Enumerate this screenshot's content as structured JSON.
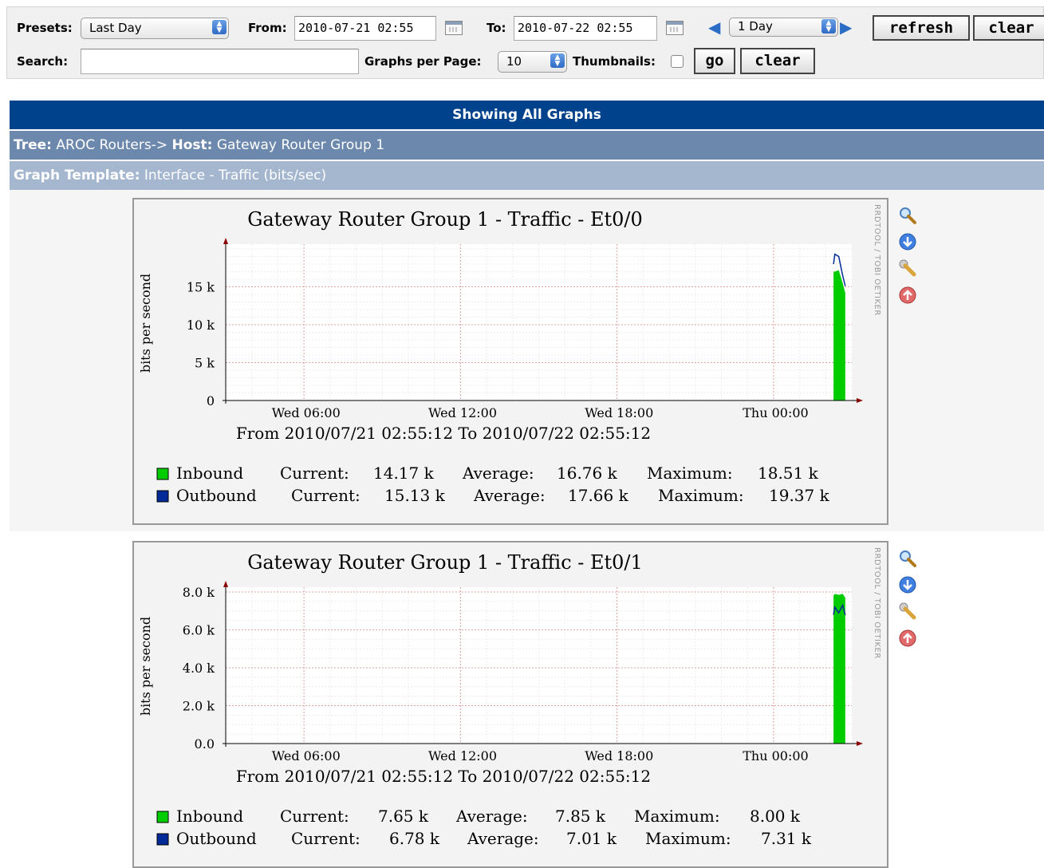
{
  "filter": {
    "presets_label": "Presets:",
    "presets_value": "Last Day",
    "from_label": "From:",
    "from_value": "2010-07-21 02:55",
    "to_label": "To:",
    "to_value": "2010-07-22 02:55",
    "timespan_value": "1 Day",
    "refresh_label": "refresh",
    "clear_label": "clear",
    "search_label": "Search:",
    "search_value": "",
    "graphs_per_page_label": "Graphs per Page:",
    "graphs_per_page_value": "10",
    "thumbnails_label": "Thumbnails:",
    "go_label": "go",
    "clear2_label": "clear"
  },
  "header": {
    "showing": "Showing All Graphs",
    "tree_label": "Tree:",
    "tree_value": "AROC Routers->",
    "host_label": "Host:",
    "host_value": "Gateway Router Group 1",
    "template_label": "Graph Template:",
    "template_value": "Interface - Traffic (bits/sec)"
  },
  "icons": [
    "zoom-icon",
    "export-icon",
    "settings-icon",
    "move-up-icon"
  ],
  "colors": {
    "inbound": "#00cc00",
    "outbound": "#002a97",
    "header": "#00438c"
  },
  "graphs": [
    {
      "title": "Gateway Router Group 1 - Traffic - Et0/0",
      "ylabel": "bits per second",
      "side_label": "RRDTOOL / TOBI OETIKER",
      "yticks": [
        "0",
        "5 k",
        "10 k",
        "15 k"
      ],
      "xticks": [
        "Wed 06:00",
        "Wed 12:00",
        "Wed 18:00",
        "Thu 00:00"
      ],
      "subtitle": "From 2010/07/21 02:55:12 To 2010/07/22 02:55:12",
      "legend": {
        "inbound": {
          "name": "Inbound",
          "current_label": "Current:",
          "current": "14.17 k",
          "average_label": "Average:",
          "average": "16.76 k",
          "maximum_label": "Maximum:",
          "maximum": "18.51 k"
        },
        "outbound": {
          "name": "Outbound",
          "current_label": "Current:",
          "current": "15.13 k",
          "average_label": "Average:",
          "average": "17.66 k",
          "maximum_label": "Maximum:",
          "maximum": "19.37 k"
        }
      }
    },
    {
      "title": "Gateway Router Group 1 - Traffic - Et0/1",
      "ylabel": "bits per second",
      "side_label": "RRDTOOL / TOBI OETIKER",
      "yticks": [
        "0.0",
        "2.0 k",
        "4.0 k",
        "6.0 k",
        "8.0 k"
      ],
      "xticks": [
        "Wed 06:00",
        "Wed 12:00",
        "Wed 18:00",
        "Thu 00:00"
      ],
      "subtitle": "From 2010/07/21 02:55:12 To 2010/07/22 02:55:12",
      "legend": {
        "inbound": {
          "name": "Inbound",
          "current_label": "Current:",
          "current": "7.65 k",
          "average_label": "Average:",
          "average": "7.85 k",
          "maximum_label": "Maximum:",
          "maximum": "8.00 k"
        },
        "outbound": {
          "name": "Outbound",
          "current_label": "Current:",
          "current": "6.78 k",
          "average_label": "Average:",
          "average": "7.01 k",
          "maximum_label": "Maximum:",
          "maximum": "7.31 k"
        }
      }
    }
  ],
  "chart_data": [
    {
      "type": "area",
      "title": "Gateway Router Group 1 - Traffic - Et0/0",
      "ylabel": "bits per second",
      "xlabel": "",
      "ylim": [
        0,
        20000
      ],
      "xlim_hours": [
        0,
        24
      ],
      "x_tick_labels": [
        "Wed 06:00",
        "Wed 12:00",
        "Wed 18:00",
        "Thu 00:00"
      ],
      "grid": true,
      "series": [
        {
          "name": "Inbound",
          "hours": [
            23.3,
            23.35,
            23.5,
            23.65,
            23.75
          ],
          "values": [
            17000,
            17000,
            17200,
            15500,
            14200
          ]
        },
        {
          "name": "Outbound",
          "hours": [
            23.3,
            23.35,
            23.5,
            23.65,
            23.75
          ],
          "values": [
            18000,
            19300,
            19000,
            16500,
            15100
          ]
        }
      ]
    },
    {
      "type": "area",
      "title": "Gateway Router Group 1 - Traffic - Et0/1",
      "ylabel": "bits per second",
      "xlabel": "",
      "ylim": [
        0,
        8000
      ],
      "xlim_hours": [
        0,
        24
      ],
      "x_tick_labels": [
        "Wed 06:00",
        "Wed 12:00",
        "Wed 18:00",
        "Thu 00:00"
      ],
      "grid": true,
      "series": [
        {
          "name": "Inbound",
          "hours": [
            23.3,
            23.35,
            23.5,
            23.65,
            23.75
          ],
          "values": [
            7800,
            7900,
            7850,
            7900,
            7700
          ]
        },
        {
          "name": "Outbound",
          "hours": [
            23.3,
            23.35,
            23.5,
            23.65,
            23.75
          ],
          "values": [
            6800,
            7200,
            6900,
            7300,
            6780
          ]
        }
      ]
    }
  ]
}
